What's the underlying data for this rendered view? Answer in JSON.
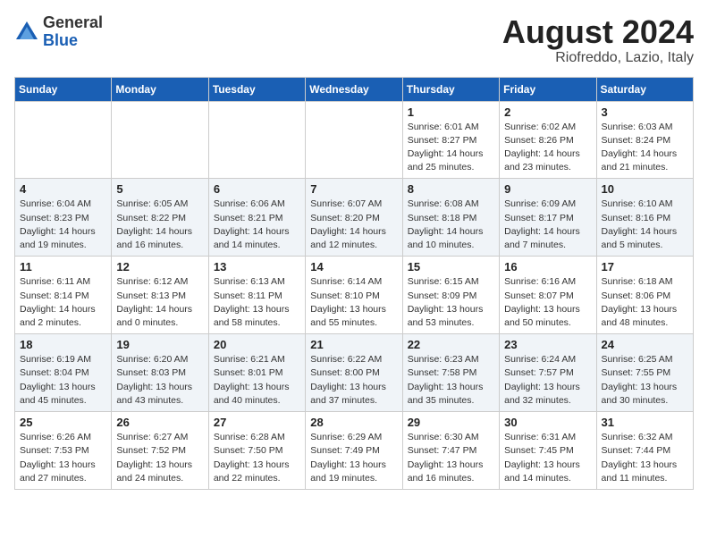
{
  "header": {
    "logo_general": "General",
    "logo_blue": "Blue",
    "title": "August 2024",
    "subtitle": "Riofreddo, Lazio, Italy"
  },
  "weekdays": [
    "Sunday",
    "Monday",
    "Tuesday",
    "Wednesday",
    "Thursday",
    "Friday",
    "Saturday"
  ],
  "weeks": [
    [
      {
        "day": "",
        "info": ""
      },
      {
        "day": "",
        "info": ""
      },
      {
        "day": "",
        "info": ""
      },
      {
        "day": "",
        "info": ""
      },
      {
        "day": "1",
        "info": "Sunrise: 6:01 AM\nSunset: 8:27 PM\nDaylight: 14 hours\nand 25 minutes."
      },
      {
        "day": "2",
        "info": "Sunrise: 6:02 AM\nSunset: 8:26 PM\nDaylight: 14 hours\nand 23 minutes."
      },
      {
        "day": "3",
        "info": "Sunrise: 6:03 AM\nSunset: 8:24 PM\nDaylight: 14 hours\nand 21 minutes."
      }
    ],
    [
      {
        "day": "4",
        "info": "Sunrise: 6:04 AM\nSunset: 8:23 PM\nDaylight: 14 hours\nand 19 minutes."
      },
      {
        "day": "5",
        "info": "Sunrise: 6:05 AM\nSunset: 8:22 PM\nDaylight: 14 hours\nand 16 minutes."
      },
      {
        "day": "6",
        "info": "Sunrise: 6:06 AM\nSunset: 8:21 PM\nDaylight: 14 hours\nand 14 minutes."
      },
      {
        "day": "7",
        "info": "Sunrise: 6:07 AM\nSunset: 8:20 PM\nDaylight: 14 hours\nand 12 minutes."
      },
      {
        "day": "8",
        "info": "Sunrise: 6:08 AM\nSunset: 8:18 PM\nDaylight: 14 hours\nand 10 minutes."
      },
      {
        "day": "9",
        "info": "Sunrise: 6:09 AM\nSunset: 8:17 PM\nDaylight: 14 hours\nand 7 minutes."
      },
      {
        "day": "10",
        "info": "Sunrise: 6:10 AM\nSunset: 8:16 PM\nDaylight: 14 hours\nand 5 minutes."
      }
    ],
    [
      {
        "day": "11",
        "info": "Sunrise: 6:11 AM\nSunset: 8:14 PM\nDaylight: 14 hours\nand 2 minutes."
      },
      {
        "day": "12",
        "info": "Sunrise: 6:12 AM\nSunset: 8:13 PM\nDaylight: 14 hours\nand 0 minutes."
      },
      {
        "day": "13",
        "info": "Sunrise: 6:13 AM\nSunset: 8:11 PM\nDaylight: 13 hours\nand 58 minutes."
      },
      {
        "day": "14",
        "info": "Sunrise: 6:14 AM\nSunset: 8:10 PM\nDaylight: 13 hours\nand 55 minutes."
      },
      {
        "day": "15",
        "info": "Sunrise: 6:15 AM\nSunset: 8:09 PM\nDaylight: 13 hours\nand 53 minutes."
      },
      {
        "day": "16",
        "info": "Sunrise: 6:16 AM\nSunset: 8:07 PM\nDaylight: 13 hours\nand 50 minutes."
      },
      {
        "day": "17",
        "info": "Sunrise: 6:18 AM\nSunset: 8:06 PM\nDaylight: 13 hours\nand 48 minutes."
      }
    ],
    [
      {
        "day": "18",
        "info": "Sunrise: 6:19 AM\nSunset: 8:04 PM\nDaylight: 13 hours\nand 45 minutes."
      },
      {
        "day": "19",
        "info": "Sunrise: 6:20 AM\nSunset: 8:03 PM\nDaylight: 13 hours\nand 43 minutes."
      },
      {
        "day": "20",
        "info": "Sunrise: 6:21 AM\nSunset: 8:01 PM\nDaylight: 13 hours\nand 40 minutes."
      },
      {
        "day": "21",
        "info": "Sunrise: 6:22 AM\nSunset: 8:00 PM\nDaylight: 13 hours\nand 37 minutes."
      },
      {
        "day": "22",
        "info": "Sunrise: 6:23 AM\nSunset: 7:58 PM\nDaylight: 13 hours\nand 35 minutes."
      },
      {
        "day": "23",
        "info": "Sunrise: 6:24 AM\nSunset: 7:57 PM\nDaylight: 13 hours\nand 32 minutes."
      },
      {
        "day": "24",
        "info": "Sunrise: 6:25 AM\nSunset: 7:55 PM\nDaylight: 13 hours\nand 30 minutes."
      }
    ],
    [
      {
        "day": "25",
        "info": "Sunrise: 6:26 AM\nSunset: 7:53 PM\nDaylight: 13 hours\nand 27 minutes."
      },
      {
        "day": "26",
        "info": "Sunrise: 6:27 AM\nSunset: 7:52 PM\nDaylight: 13 hours\nand 24 minutes."
      },
      {
        "day": "27",
        "info": "Sunrise: 6:28 AM\nSunset: 7:50 PM\nDaylight: 13 hours\nand 22 minutes."
      },
      {
        "day": "28",
        "info": "Sunrise: 6:29 AM\nSunset: 7:49 PM\nDaylight: 13 hours\nand 19 minutes."
      },
      {
        "day": "29",
        "info": "Sunrise: 6:30 AM\nSunset: 7:47 PM\nDaylight: 13 hours\nand 16 minutes."
      },
      {
        "day": "30",
        "info": "Sunrise: 6:31 AM\nSunset: 7:45 PM\nDaylight: 13 hours\nand 14 minutes."
      },
      {
        "day": "31",
        "info": "Sunrise: 6:32 AM\nSunset: 7:44 PM\nDaylight: 13 hours\nand 11 minutes."
      }
    ]
  ]
}
